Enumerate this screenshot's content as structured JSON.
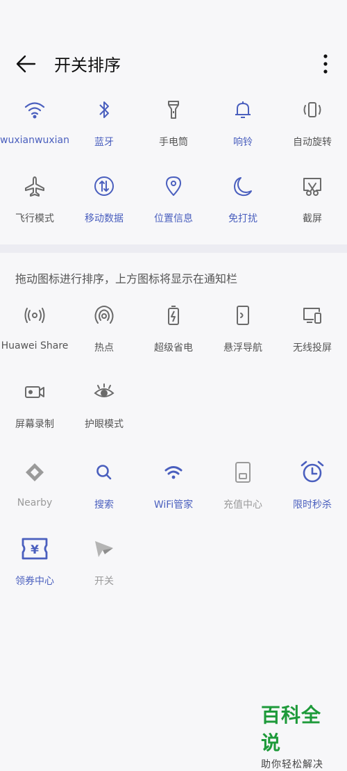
{
  "header": {
    "title": "开关排序"
  },
  "top_tiles": [
    {
      "label": "wuxianwuxian",
      "icon": "wifi-icon",
      "active": true
    },
    {
      "label": "蓝牙",
      "icon": "bluetooth-icon",
      "active": true
    },
    {
      "label": "手电筒",
      "icon": "flashlight-icon",
      "active": false
    },
    {
      "label": "响铃",
      "icon": "bell-icon",
      "active": true
    },
    {
      "label": "自动旋转",
      "icon": "rotate-icon",
      "active": false
    },
    {
      "label": "飞行模式",
      "icon": "airplane-icon",
      "active": false
    },
    {
      "label": "移动数据",
      "icon": "mobile-data-icon",
      "active": true
    },
    {
      "label": "位置信息",
      "icon": "location-icon",
      "active": true
    },
    {
      "label": "免打扰",
      "icon": "moon-icon",
      "active": true
    },
    {
      "label": "截屏",
      "icon": "screenshot-icon",
      "active": false
    }
  ],
  "hint_text": "拖动图标进行排序，上方图标将显示在通知栏",
  "bottom_tiles": [
    {
      "label": "Huawei Share",
      "icon": "share-icon"
    },
    {
      "label": "热点",
      "icon": "hotspot-icon"
    },
    {
      "label": "超级省电",
      "icon": "battery-icon"
    },
    {
      "label": "悬浮导航",
      "icon": "float-nav-icon"
    },
    {
      "label": "无线投屏",
      "icon": "cast-icon"
    },
    {
      "label": "屏幕录制",
      "icon": "screen-record-icon"
    },
    {
      "label": "护眼模式",
      "icon": "eye-icon"
    }
  ],
  "extra_tiles": [
    {
      "label": "Nearby",
      "icon": "nearby-icon",
      "style": "light"
    },
    {
      "label": "搜索",
      "icon": "search-icon",
      "style": "blue"
    },
    {
      "label": "WiFi管家",
      "icon": "wifi-manager-icon",
      "style": "blue"
    },
    {
      "label": "充值中心",
      "icon": "recharge-icon",
      "style": "light"
    },
    {
      "label": "限时秒杀",
      "icon": "alarm-clock-icon",
      "style": "blue"
    },
    {
      "label": "领券中心",
      "icon": "coupon-icon",
      "style": "blue"
    },
    {
      "label": "开关",
      "icon": "paper-plane-icon",
      "style": "light"
    }
  ],
  "watermark": {
    "title": "百科全说",
    "subtitle": "助你轻松解决"
  },
  "colors": {
    "accent": "#4a5fbe",
    "gray_icon": "#6a6a6a",
    "watermark": "#1e9a3a"
  }
}
